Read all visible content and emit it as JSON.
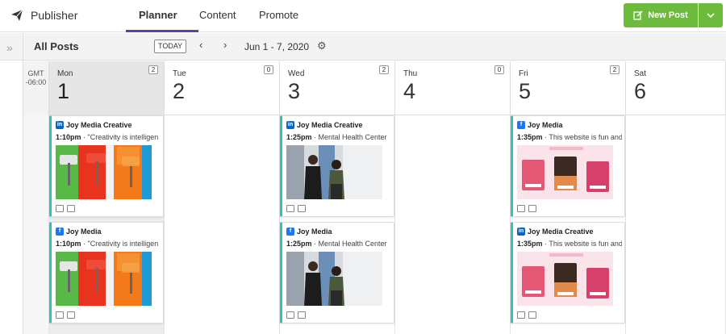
{
  "app": {
    "name": "Publisher"
  },
  "tabs": [
    {
      "label": "Planner",
      "active": true
    },
    {
      "label": "Content",
      "active": false
    },
    {
      "label": "Promote",
      "active": false
    }
  ],
  "new_post": {
    "label": "New Post"
  },
  "toolbar": {
    "title": "All Posts",
    "today": "TODAY",
    "date_range": "Jun 1 - 7, 2020"
  },
  "timezone": {
    "line1": "GMT",
    "line2": "-06:00"
  },
  "days": [
    {
      "name": "Mon",
      "num": "1",
      "count": "2",
      "today": true
    },
    {
      "name": "Tue",
      "num": "2",
      "count": "0"
    },
    {
      "name": "Wed",
      "num": "3",
      "count": "2"
    },
    {
      "name": "Thu",
      "num": "4",
      "count": "0"
    },
    {
      "name": "Fri",
      "num": "5",
      "count": "2"
    },
    {
      "name": "Sat",
      "num": "6"
    }
  ],
  "posts": [
    {
      "day": 0,
      "slot": 0,
      "network": "linkedin",
      "account": "Joy Media Creative",
      "time": "1:10pm",
      "text": "\"Creativity is intelligen",
      "image": "paint-rollers"
    },
    {
      "day": 0,
      "slot": 1,
      "network": "facebook",
      "account": "Joy Media",
      "time": "1:10pm",
      "text": "\"Creativity is intelligen",
      "image": "paint-rollers"
    },
    {
      "day": 2,
      "slot": 0,
      "network": "linkedin",
      "account": "Joy Media Creative",
      "time": "1:25pm",
      "text": "Mental Health Center",
      "image": "office-conversation"
    },
    {
      "day": 2,
      "slot": 1,
      "network": "facebook",
      "account": "Joy Media",
      "time": "1:25pm",
      "text": "Mental Health Center",
      "image": "office-conversation"
    },
    {
      "day": 4,
      "slot": 0,
      "network": "facebook",
      "account": "Joy Media",
      "time": "1:35pm",
      "text": "This website is fun and",
      "image": "pink-website-mockup"
    },
    {
      "day": 4,
      "slot": 1,
      "network": "linkedin",
      "account": "Joy Media Creative",
      "time": "1:35pm",
      "text": "This website is fun and",
      "image": "pink-website-mockup"
    }
  ],
  "colors": {
    "accent": "#5b3fb5",
    "new_post": "#6cbb3c",
    "card_border": "#2ec4b6",
    "linkedin": "#0a66c2",
    "facebook": "#1877f2"
  }
}
